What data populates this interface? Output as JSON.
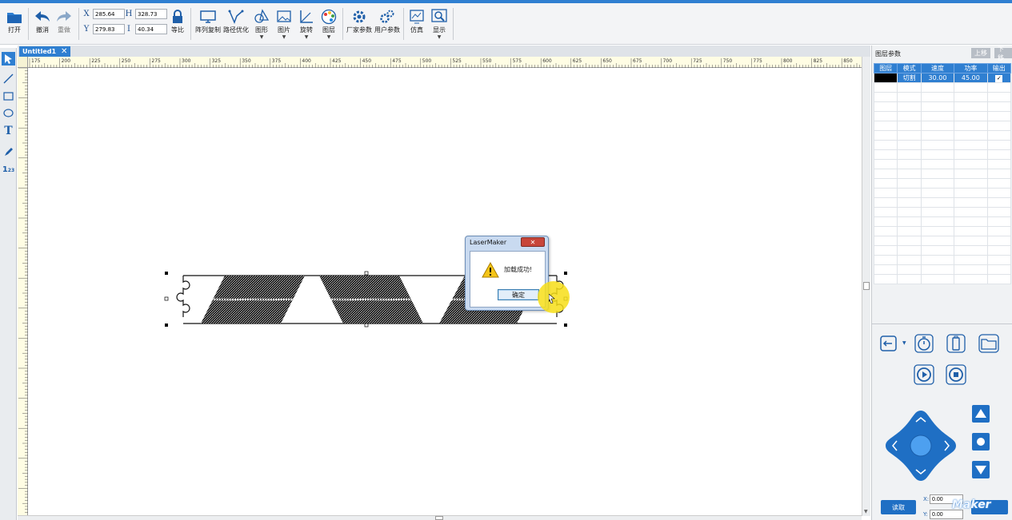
{
  "toolbar": {
    "open": "打开",
    "undo": "撤消",
    "redo": "重做",
    "lock_ratio": "等比",
    "array_copy": "阵列复制",
    "path_opt": "路径优化",
    "shape": "图形",
    "image": "图片",
    "rotate": "旋转",
    "layer": "图层",
    "vendor_params": "厂家参数",
    "user_params": "用户参数",
    "simulate": "仿真",
    "display": "显示"
  },
  "coords": {
    "x_label": "X",
    "x": "285.64",
    "y_label": "Y",
    "y": "279.83",
    "h_label": "H",
    "h": "328.73",
    "w_label": "I",
    "w": "40.34"
  },
  "tab": {
    "title": "Untitled1",
    "close": "✕"
  },
  "ruler": {
    "h_ticks": [
      "175",
      "200",
      "225",
      "250",
      "275",
      "300",
      "325",
      "350",
      "375",
      "400",
      "425",
      "450",
      "475",
      "500",
      "525",
      "550",
      "575",
      "600",
      "625",
      "650",
      "675",
      "700",
      "725",
      "750",
      "775",
      "800",
      "825",
      "850"
    ]
  },
  "layers": {
    "title": "图层参数",
    "up": "上移",
    "down": "下移",
    "headers": [
      "图层",
      "模式",
      "速度",
      "功率",
      "输出"
    ],
    "rows": [
      {
        "mode": "切割",
        "speed": "30.00",
        "power": "45.00",
        "output": "✓"
      }
    ]
  },
  "panel": {
    "read": "读取",
    "x_label": "X:",
    "x": "0.00",
    "y_label": "Y:",
    "y": "0.00"
  },
  "dialog": {
    "title": "LaserMaker",
    "close": "✕",
    "message": "加载成功!",
    "ok": "确定"
  },
  "watermark": "Maker",
  "colors": {
    "accent": "#2f7fd1",
    "dark_blue": "#1f6fc4",
    "highlight": "#f7de18"
  }
}
